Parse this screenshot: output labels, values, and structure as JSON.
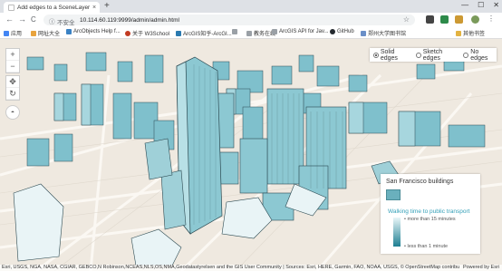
{
  "browser": {
    "tab_title": "Add edges to a SceneLayer - ...",
    "tab_close": "×",
    "new_tab": "+",
    "win_min": "—",
    "win_max": "☐",
    "win_close": "✕",
    "nav_back": "←",
    "nav_forward": "→",
    "nav_reload": "C",
    "security_label": "不安全",
    "url": "10.114.60.119:9999/admin/admin.html",
    "bookmark_star": "☆"
  },
  "bookmarks": [
    {
      "label": "应用",
      "color": "#4285f4"
    },
    {
      "label": "网址大全",
      "color": "#e8a33d"
    },
    {
      "label": "ArcObjects Help f...",
      "color": "#3b82c4"
    },
    {
      "label": "关于 W3School",
      "color": "#c23b22"
    },
    {
      "label": "ArcGIS知乎-ArcGI...",
      "color": "#2a7ab0"
    },
    {
      "label": "",
      "color": "#9aa0a6"
    },
    {
      "label": "教务在线",
      "color": "#9aa0a6"
    },
    {
      "label": "ArcGIS API for Jav...",
      "color": "#9aa0a6"
    },
    {
      "label": "GitHub",
      "color": "#24292e"
    },
    {
      "label": "郑州大学图书馆",
      "color": "#6a8fc8"
    }
  ],
  "bookmarks_other": "其他书签",
  "map": {
    "zoom_in": "+",
    "zoom_out": "−",
    "pan_icon": "✥",
    "rotate_icon": "↻",
    "compass_icon": "◓"
  },
  "edge_options": {
    "selected": "Solid edges",
    "options": [
      "Solid edges",
      "Sketch edges",
      "No edges"
    ]
  },
  "legend": {
    "layer_title": "San Francisco buildings",
    "field": "Walking time to public transport",
    "more_label": "more than 15 minutes",
    "less_label": "less than 1 minute"
  },
  "attribution": {
    "text": "Esri, USGS, NGA, NASA, CGIAR, GEBCO,N Robinson,NCEAS,NLS,OS,NMA,Geodatastyrelsen and the GIS User Community | Sources: Esri, HERE, Garmin, FAO, NOAA, USGS, © OpenStreetMap contributors, an...",
    "powered_by": "Powered by Esri"
  }
}
